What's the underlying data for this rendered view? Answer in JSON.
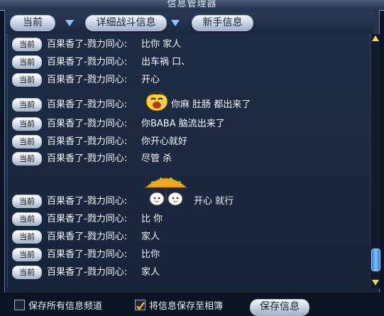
{
  "window": {
    "title": "信息管理器"
  },
  "tabs": {
    "current": "当前",
    "combat_detail": "详细战斗信息",
    "newbie_info": "新手信息"
  },
  "chat": {
    "tag_label": "当前",
    "sender": "百果香了-戮力同心:",
    "messages": [
      {
        "text": "比你 家人"
      },
      {
        "text": "出车祸 口、"
      },
      {
        "text": "开心"
      },
      {
        "text": "你麻  肚肠 都出来了",
        "emoticon": "laughing-face-icon"
      },
      {
        "text": "你BABA  脑流出来了"
      },
      {
        "text": "你开心就好"
      },
      {
        "text": "尽管 杀"
      },
      {
        "text": "开心 就行",
        "emoticon": "umbrella-friends-icon"
      },
      {
        "text": "比 你"
      },
      {
        "text": "家人"
      },
      {
        "text": "比你"
      },
      {
        "text": "家人"
      }
    ]
  },
  "bottom": {
    "checkbox1_label": "保存所有信息频道",
    "checkbox2_label": "将信息保存至相簿",
    "checkbox2_checked": true,
    "save_button": "保存信息"
  },
  "colors": {
    "accent_blue": "#8fc3ff",
    "text": "#f4f7fb",
    "panel_bg": "#1e2c45"
  }
}
